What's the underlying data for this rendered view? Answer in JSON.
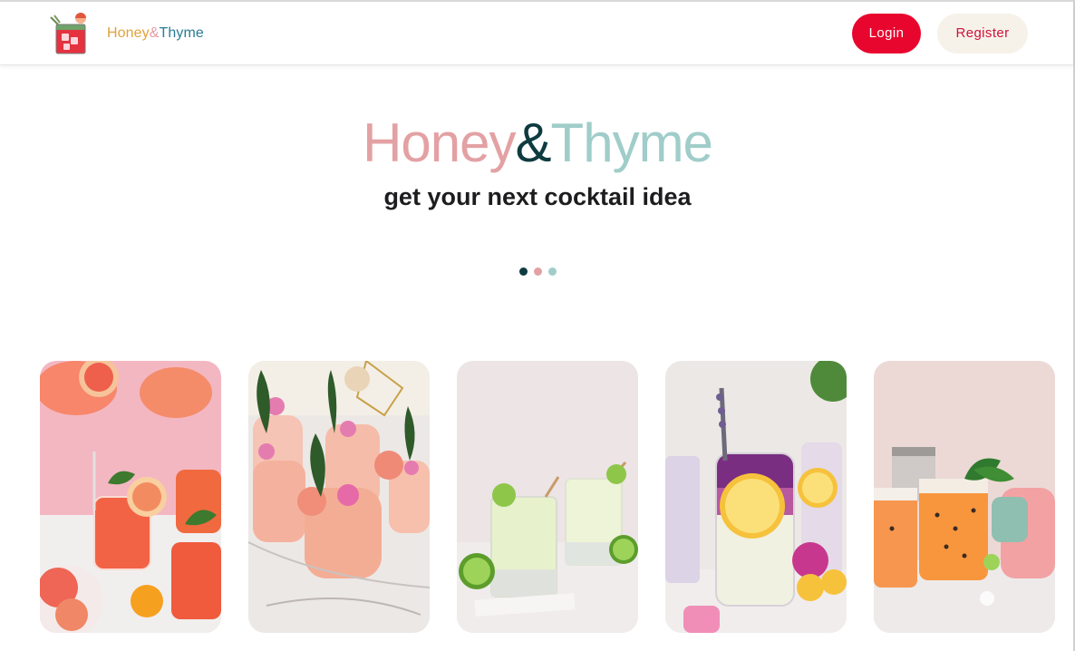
{
  "brand": {
    "part1": "Honey",
    "amp": "&",
    "part2": "Thyme",
    "logo_icon": "cocktail-glass-icon"
  },
  "nav": {
    "login_label": "Login",
    "register_label": "Register"
  },
  "hero": {
    "title_part1": "Honey",
    "title_amp": "&",
    "title_part2": "Thyme",
    "subtitle": "get your next cocktail idea"
  },
  "carousel": {
    "dots": [
      "#0e3b40",
      "#e3a1a3",
      "#a0cdc9"
    ],
    "active_index": 0
  },
  "cards": [
    {
      "theme": "grapefruit-spritz"
    },
    {
      "theme": "peach-slushie"
    },
    {
      "theme": "lime-frozen-margarita"
    },
    {
      "theme": "lavender-lemonade"
    },
    {
      "theme": "passionfruit-cocktail"
    }
  ],
  "colors": {
    "login_bg": "#e8062e",
    "register_bg": "#f6f2ea",
    "register_text": "#d1113a"
  }
}
